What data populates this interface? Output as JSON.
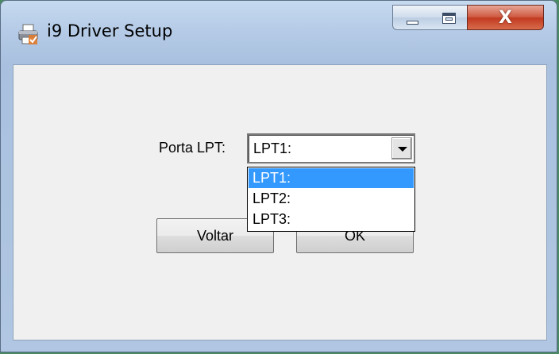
{
  "window": {
    "title": "i9 Driver Setup",
    "icon": "printer-icon",
    "controls": {
      "minimize": "minimize-icon",
      "maximize": "maximize-icon",
      "close": "close-icon",
      "close_glyph": "X"
    }
  },
  "form": {
    "port_label": "Porta LPT:",
    "port_value": "LPT1:",
    "port_options": [
      "LPT1:",
      "LPT2:",
      "LPT3:"
    ],
    "selected_index": 0
  },
  "buttons": {
    "back_label": "Voltar",
    "ok_label": "OK"
  },
  "colors": {
    "selection": "#3399ff",
    "close_button": "#c13a20"
  }
}
